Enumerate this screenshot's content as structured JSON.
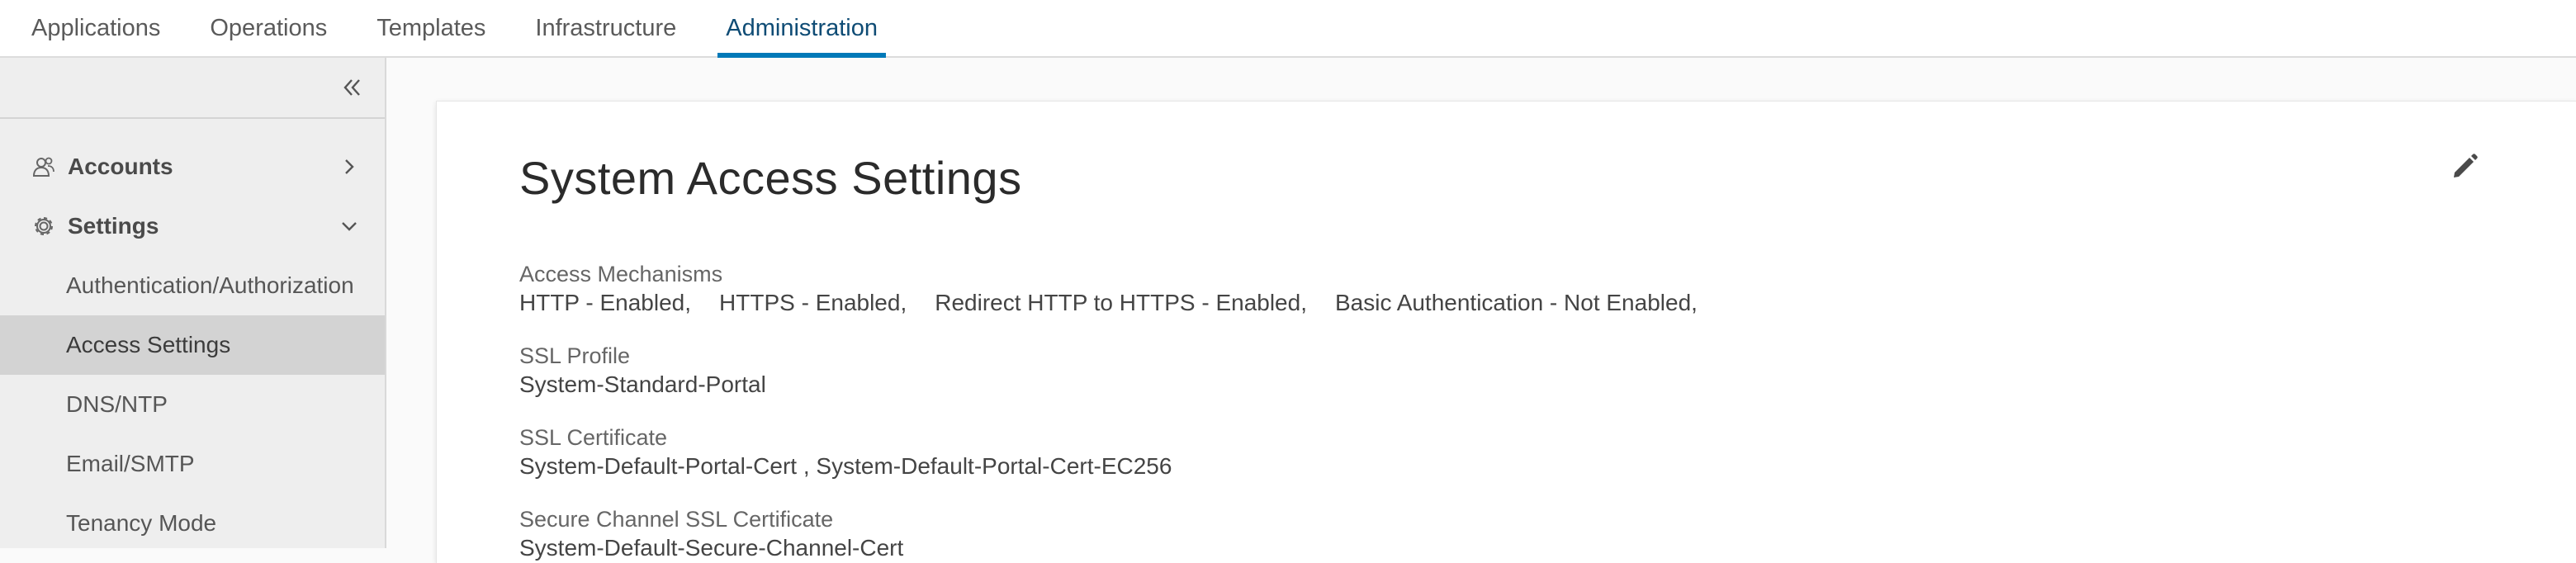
{
  "top_nav": {
    "tabs": [
      {
        "label": "Applications",
        "active": false
      },
      {
        "label": "Operations",
        "active": false
      },
      {
        "label": "Templates",
        "active": false
      },
      {
        "label": "Infrastructure",
        "active": false
      },
      {
        "label": "Administration",
        "active": true
      }
    ]
  },
  "sidebar": {
    "collapse_icon": "double-chevron-left-icon",
    "groups": [
      {
        "label": "Accounts",
        "icon": "user-group-icon",
        "expanded": false
      },
      {
        "label": "Settings",
        "icon": "gear-icon",
        "expanded": true
      }
    ],
    "items": [
      {
        "label": "Authentication/Authorization",
        "selected": false
      },
      {
        "label": "Access Settings",
        "selected": true
      },
      {
        "label": "DNS/NTP",
        "selected": false
      },
      {
        "label": "Email/SMTP",
        "selected": false
      },
      {
        "label": "Tenancy Mode",
        "selected": false
      }
    ]
  },
  "main": {
    "title": "System Access Settings",
    "edit_icon": "pencil-icon",
    "fields": [
      {
        "label": "Access Mechanisms",
        "values": [
          "HTTP - Enabled,",
          "HTTPS - Enabled,",
          "Redirect HTTP to HTTPS - Enabled,",
          "Basic Authentication - Not Enabled,"
        ]
      },
      {
        "label": "SSL Profile",
        "value": "System-Standard-Portal"
      },
      {
        "label": "SSL Certificate",
        "value": "System-Default-Portal-Cert , System-Default-Portal-Cert-EC256"
      },
      {
        "label": "Secure Channel SSL Certificate",
        "value": "System-Default-Secure-Channel-Cert"
      }
    ]
  },
  "colors": {
    "active_tab_underline": "#0079b8",
    "sidebar_bg": "#eeeeee",
    "sidebar_selected_bg": "#d3d3d3"
  }
}
